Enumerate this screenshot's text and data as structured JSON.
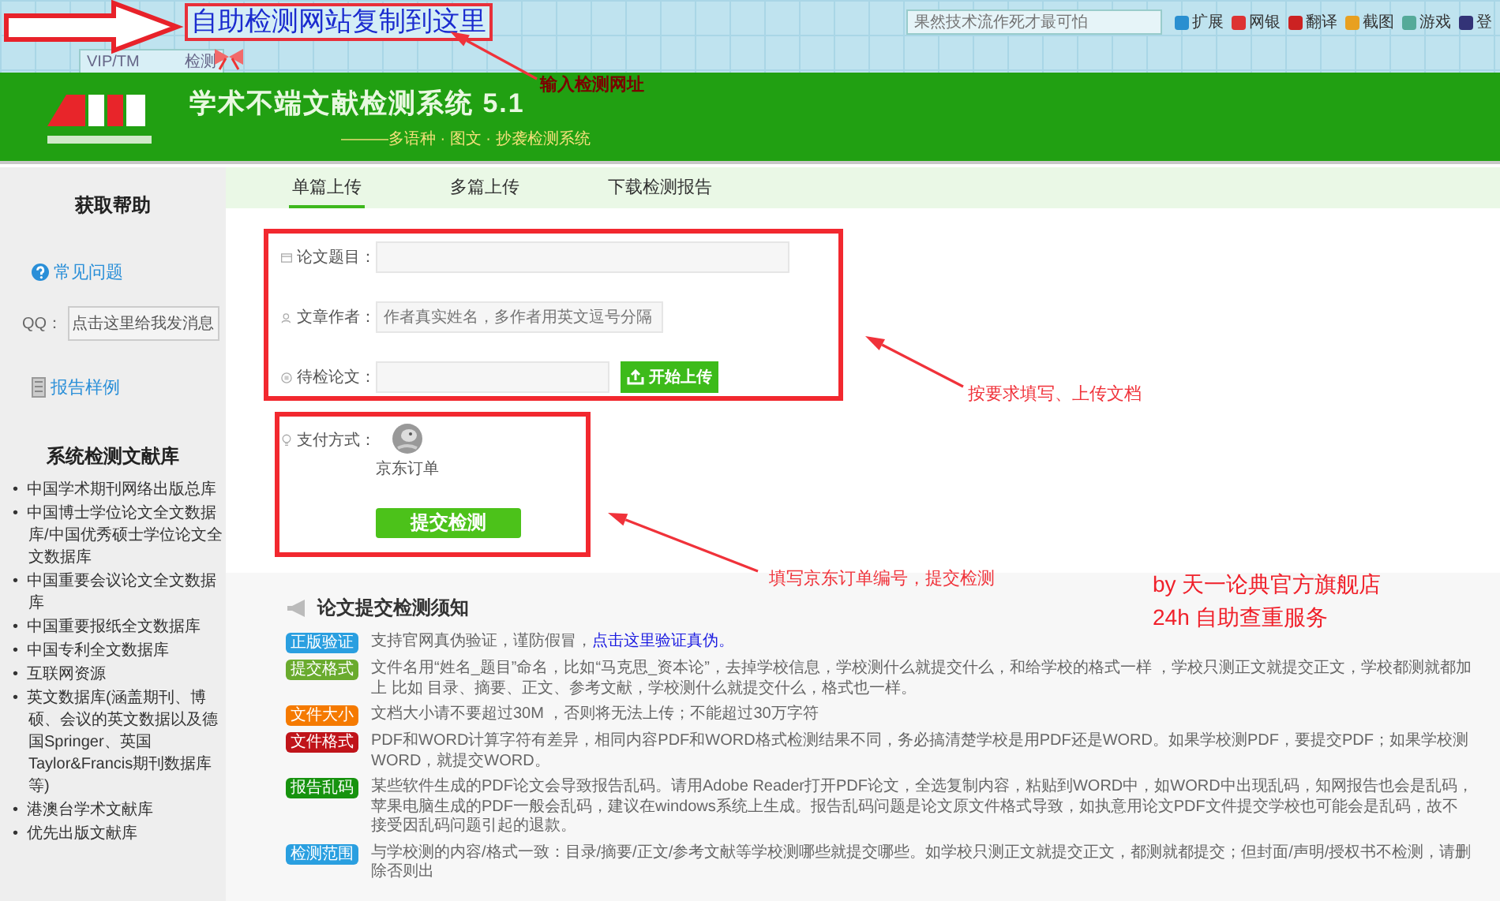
{
  "browser": {
    "address_note": "自助检测网站复制到这里",
    "tab_label_parts": [
      "VIP/TM",
      "检测"
    ],
    "search": {
      "placeholder": "果然技术流作死才最可怕"
    },
    "toolbar": [
      "扩展",
      "网银",
      "翻译",
      "截图",
      "游戏",
      "登"
    ]
  },
  "header": {
    "title": "学术不端文献检测系统 5.1",
    "subtitle": "———多语种 · 图文 · 抄袭检测系统"
  },
  "sidebar": {
    "help_title": "获取帮助",
    "faq_link": "常见问题",
    "qq_label": "QQ：",
    "qq_button": "点击这里给我发消息",
    "sample_link": "报告样例",
    "library_title": "系统检测文献库",
    "library_marker": "•",
    "libraries": [
      "中国学术期刊网络出版总库",
      "中国博士学位论文全文数据库/中国优秀硕士学位论文全文数据库",
      "中国重要会议论文全文数据库",
      "中国重要报纸全文数据库",
      "中国专利全文数据库",
      "互联网资源",
      "英文数据库(涵盖期刊、博硕、会议的英文数据以及德国Springer、英国Taylor&Francis期刊数据库等)",
      "港澳台学术文献库",
      "优先出版文献库"
    ]
  },
  "tabs": [
    {
      "label": "单篇上传",
      "selected": true
    },
    {
      "label": "多篇上传",
      "selected": false
    },
    {
      "label": "下载检测报告",
      "selected": false
    }
  ],
  "form": {
    "fields": [
      {
        "kind": "text",
        "label": "论文题目："
      },
      {
        "kind": "author",
        "label": "文章作者：",
        "placeholder": "作者真实姓名，多作者用英文逗号分隔"
      },
      {
        "kind": "file",
        "label": "待检论文：",
        "button": "开始上传"
      }
    ],
    "payment": {
      "label": "支付方式：",
      "option": "京东订单"
    },
    "submit": "提交检测"
  },
  "notice": {
    "title": "论文提交检测须知",
    "items": [
      {
        "tag": "正版验证",
        "color": "#2a9fe0",
        "text": "支持官网真伪验证，谨防假冒，",
        "link": "点击这里验证真伪。"
      },
      {
        "tag": "提交格式",
        "color": "#6aab2e",
        "text": "文件名用“姓名_题目”命名，比如“马克思_资本论”，去掉学校信息，学校测什么就提交什么，和给学校的格式一样 ，学校只测正文就提交正文，学校都测就都加上 比如 目录、摘要、正文、参考文献，学校测什么就提交什么，格式也一样。"
      },
      {
        "tag": "文件大小",
        "color": "#f57a00",
        "text": "文档大小请不要超过30M ，否则将无法上传；不能超过30万字符"
      },
      {
        "tag": "文件格式",
        "color": "#c0141a",
        "text": "PDF和WORD计算字符有差异，相同内容PDF和WORD格式检测结果不同，务必搞清楚学校是用PDF还是WORD。如果学校测PDF，要提交PDF；如果学校测WORD，就提交WORD。"
      },
      {
        "tag": "报告乱码",
        "color": "#17930f",
        "text": "某些软件生成的PDF论文会导致报告乱码。请用Adobe Reader打开PDF论文，全选复制内容，粘贴到WORD中，如WORD中出现乱码，知网报告也会是乱码，苹果电脑生成的PDF一般会乱码，建议在windows系统上生成。报告乱码问题是论文原文件格式导致，如执意用论文PDF文件提交学校也可能会是乱码，故不接受因乱码问题引起的退款。"
      },
      {
        "tag": "检测范围",
        "color": "#2a9fe0",
        "text": "与学校测的内容/格式一致：目录/摘要/正文/参考文献等学校测哪些就提交哪些。如学校只测正文就提交正文，都测就都提交；但封面/声明/授权书不检测，请删除否则出"
      }
    ]
  },
  "annotations": [
    {
      "kind": "url",
      "text": "输入检测网址"
    },
    {
      "kind": "form",
      "text": "按要求填写、上传文档"
    },
    {
      "kind": "payment",
      "text": "填写京东订单编号，提交检测"
    }
  ],
  "promo": [
    "by 天一论典官方旗舰店",
    "24h 自助查重服务"
  ]
}
